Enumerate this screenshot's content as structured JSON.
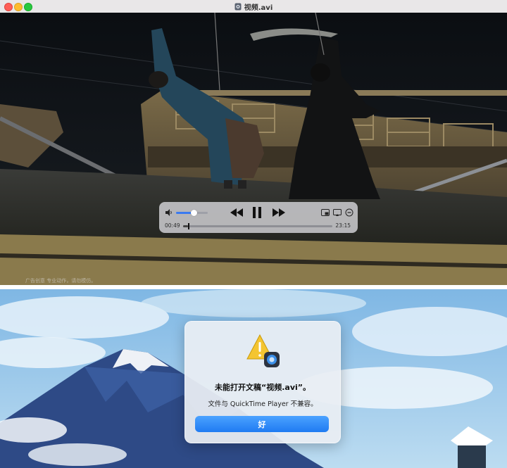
{
  "window": {
    "title": "视频.avi",
    "controls": [
      "close",
      "minimize",
      "zoom"
    ]
  },
  "video": {
    "subtitle": "广告创意 专业动作，请勿模仿。"
  },
  "player": {
    "current_time": "00:49",
    "end_time": "23:15",
    "progress_fraction": 0.035,
    "volume_fraction": 0.55,
    "icons": [
      "volume-icon",
      "rewind-icon",
      "pause-icon",
      "fast-forward-icon",
      "picture-in-picture-icon",
      "share-icon",
      "more-icon"
    ]
  },
  "alert": {
    "title": "未能打开文稿“视频.avi”。",
    "message": "文件与 QuickTime Player 不兼容。",
    "button_label": "好",
    "icon": "warning-quicktime-icon"
  },
  "colors": {
    "accent": "#1f7bf2",
    "volume_fill": "#3a7af0"
  }
}
